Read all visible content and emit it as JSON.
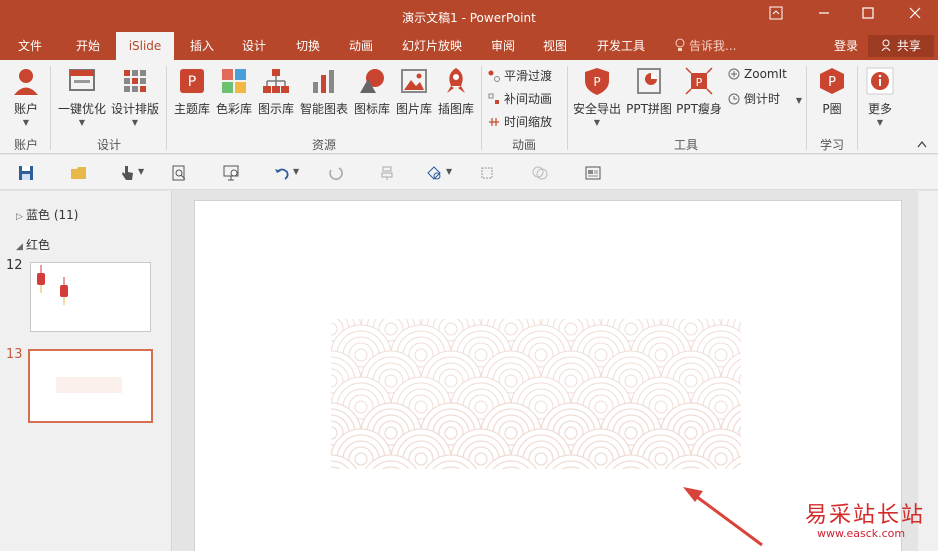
{
  "window": {
    "title": "演示文稿1 - PowerPoint",
    "controls": [
      "ribbon-display",
      "minimize",
      "maximize",
      "close"
    ]
  },
  "tabs": [
    "文件",
    "开始",
    "iSlide",
    "插入",
    "设计",
    "切换",
    "动画",
    "幻灯片放映",
    "审阅",
    "视图",
    "开发工具"
  ],
  "active_tab": "iSlide",
  "tell_me": "告诉我...",
  "login": "登录",
  "share": "共享",
  "ribbon": {
    "groups": {
      "account": "账户",
      "design": "设计",
      "resources": "资源",
      "animation": "动画",
      "tools": "工具",
      "learn": "学习"
    },
    "buttons": {
      "account": "账户",
      "one_click": "一键优化",
      "design_layout": "设计排版",
      "theme_lib": "主题库",
      "color_lib": "色彩库",
      "diagram_lib": "图示库",
      "smart_chart": "智能图表",
      "icon_lib": "图标库",
      "picture_lib": "图片库",
      "illustration_lib": "插图库",
      "smooth_transition": "平滑过渡",
      "tween_animation": "补间动画",
      "time_scale": "时间缩放",
      "safe_export": "安全导出",
      "ppt_collage": "PPT拼图",
      "ppt_slim": "PPT瘦身",
      "zoomit": "ZoomIt",
      "countdown": "倒计时",
      "p_circle": "P圈",
      "more": "更多"
    }
  },
  "colors": {
    "accent": "#b7472a",
    "active_thumb_border": "#d4704f",
    "pattern_stroke": "#f0ddd6"
  },
  "panel": {
    "sections": [
      {
        "label": "蓝色 (11)",
        "expanded": false
      },
      {
        "label": "红色",
        "expanded": true
      }
    ],
    "slides": [
      {
        "number": "12",
        "selected": false
      },
      {
        "number": "13",
        "selected": true
      }
    ]
  },
  "watermark": {
    "cn": "易采站长站",
    "url": "www.easck.com"
  }
}
